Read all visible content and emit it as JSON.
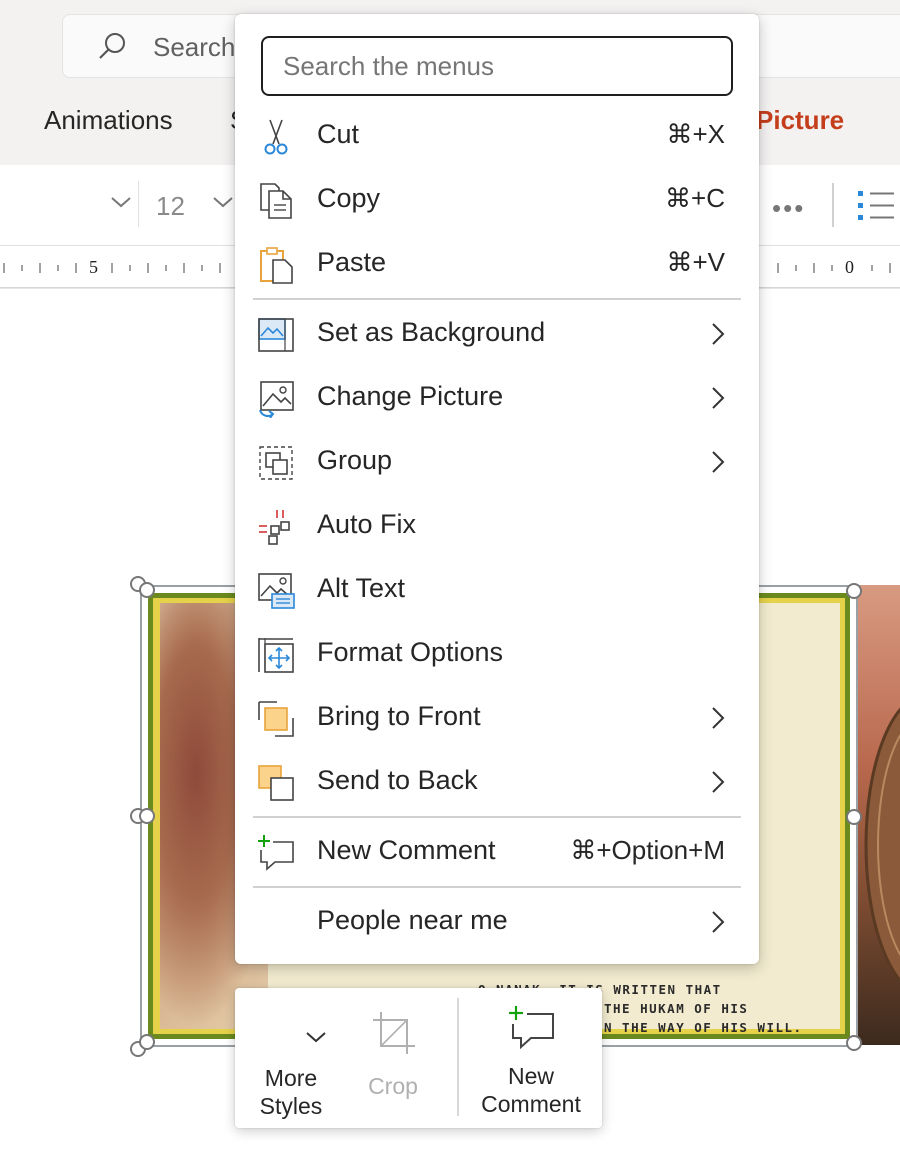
{
  "ribbon": {
    "search_placeholder": "Search",
    "tabs": [
      {
        "label": "Animations"
      },
      {
        "label": "S"
      },
      {
        "label": "Picture"
      }
    ],
    "font_size": "12"
  },
  "ruler": {
    "labels": [
      "5",
      "0"
    ]
  },
  "context_menu": {
    "search_placeholder": "Search the menus",
    "items": [
      {
        "label": "Cut",
        "shortcut": "⌘+X",
        "icon": "scissors-icon"
      },
      {
        "label": "Copy",
        "shortcut": "⌘+C",
        "icon": "copy-icon"
      },
      {
        "label": "Paste",
        "shortcut": "⌘+V",
        "icon": "paste-icon"
      },
      {
        "label": "Set as Background",
        "icon": "background-icon",
        "submenu": true
      },
      {
        "label": "Change Picture",
        "icon": "change-picture-icon",
        "submenu": true
      },
      {
        "label": "Group",
        "icon": "group-icon",
        "submenu": true
      },
      {
        "label": "Auto Fix",
        "icon": "auto-fix-icon"
      },
      {
        "label": "Alt Text",
        "icon": "alt-text-icon"
      },
      {
        "label": "Format Options",
        "icon": "format-options-icon"
      },
      {
        "label": "Bring to Front",
        "icon": "bring-to-front-icon",
        "submenu": true
      },
      {
        "label": "Send to Back",
        "icon": "send-to-back-icon",
        "submenu": true
      },
      {
        "label": "New Comment",
        "shortcut": "⌘+Option+M",
        "icon": "new-comment-icon"
      },
      {
        "label": "People near me",
        "submenu": true
      }
    ]
  },
  "mini_toolbar": {
    "more_styles_line1": "More",
    "more_styles_line2": "Styles",
    "crop_label": "Crop",
    "new_comment_line1": "New",
    "new_comment_line2": "Comment"
  },
  "slide_text": {
    "line1": "O NANAK, IT IS WRITTEN THAT",
    "line2": "THE HUKAM OF HIS",
    "line3": "N THE WAY OF HIS WILL."
  },
  "colors": {
    "accent_picture_tab": "#c43e1c",
    "icon_blue": "#2b88d8",
    "icon_orange": "#e8a33b",
    "icon_red": "#d13438",
    "icon_green": "#13a10e"
  }
}
